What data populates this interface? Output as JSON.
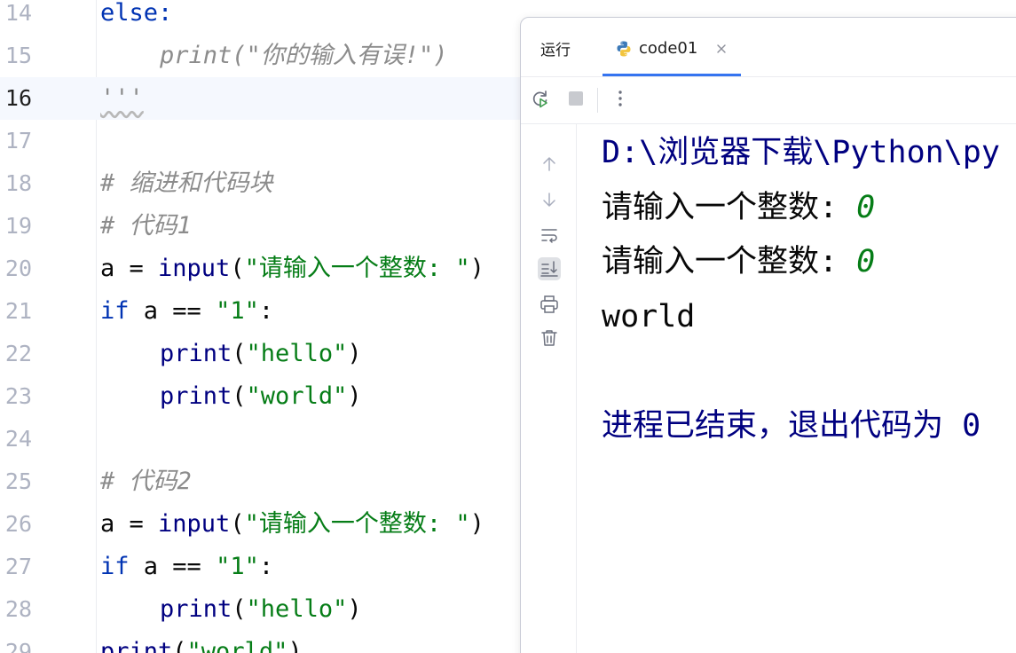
{
  "editor": {
    "lines": [
      {
        "no": "14",
        "parts": [
          {
            "text": "else:",
            "cls": "t-kw"
          }
        ]
      },
      {
        "no": "15",
        "indent": 1,
        "parts": [
          {
            "text": "print(\"你的输入有误!\")",
            "cls": "t-docstr"
          }
        ]
      },
      {
        "no": "16",
        "current": true,
        "parts": [
          {
            "text": "'''",
            "cls": "t-docq"
          }
        ]
      },
      {
        "no": "17",
        "parts": []
      },
      {
        "no": "18",
        "parts": [
          {
            "text": "# 缩进和代码块",
            "cls": "t-cm"
          }
        ]
      },
      {
        "no": "19",
        "parts": [
          {
            "text": "# 代码1",
            "cls": "t-cm"
          }
        ]
      },
      {
        "no": "20",
        "parts": [
          {
            "text": "a = ",
            "cls": ""
          },
          {
            "text": "input",
            "cls": "t-fn"
          },
          {
            "text": "(",
            "cls": ""
          },
          {
            "text": "\"请输入一个整数: \"",
            "cls": "t-str"
          },
          {
            "text": ")",
            "cls": ""
          }
        ]
      },
      {
        "no": "21",
        "parts": [
          {
            "text": "if",
            "cls": "t-kw"
          },
          {
            "text": " a == ",
            "cls": ""
          },
          {
            "text": "\"1\"",
            "cls": "t-str"
          },
          {
            "text": ":",
            "cls": ""
          }
        ]
      },
      {
        "no": "22",
        "indent": 1,
        "parts": [
          {
            "text": "print",
            "cls": "t-fn"
          },
          {
            "text": "(",
            "cls": ""
          },
          {
            "text": "\"hello\"",
            "cls": "t-str"
          },
          {
            "text": ")",
            "cls": ""
          }
        ]
      },
      {
        "no": "23",
        "indent": 1,
        "parts": [
          {
            "text": "print",
            "cls": "t-fn"
          },
          {
            "text": "(",
            "cls": ""
          },
          {
            "text": "\"world\"",
            "cls": "t-str"
          },
          {
            "text": ")",
            "cls": ""
          }
        ]
      },
      {
        "no": "24",
        "parts": []
      },
      {
        "no": "25",
        "parts": [
          {
            "text": "# 代码2",
            "cls": "t-cm"
          }
        ]
      },
      {
        "no": "26",
        "parts": [
          {
            "text": "a = ",
            "cls": ""
          },
          {
            "text": "input",
            "cls": "t-fn"
          },
          {
            "text": "(",
            "cls": ""
          },
          {
            "text": "\"请输入一个整数: \"",
            "cls": "t-str"
          },
          {
            "text": ")",
            "cls": ""
          }
        ]
      },
      {
        "no": "27",
        "parts": [
          {
            "text": "if",
            "cls": "t-kw"
          },
          {
            "text": " a == ",
            "cls": ""
          },
          {
            "text": "\"1\"",
            "cls": "t-str"
          },
          {
            "text": ":",
            "cls": ""
          }
        ]
      },
      {
        "no": "28",
        "indent": 1,
        "parts": [
          {
            "text": "print",
            "cls": "t-fn"
          },
          {
            "text": "(",
            "cls": ""
          },
          {
            "text": "\"hello\"",
            "cls": "t-str"
          },
          {
            "text": ")",
            "cls": ""
          }
        ]
      },
      {
        "no": "29",
        "parts": [
          {
            "text": "print",
            "cls": "t-fn"
          },
          {
            "text": "(",
            "cls": ""
          },
          {
            "text": "\"world\"",
            "cls": "t-str"
          },
          {
            "text": ")",
            "cls": ""
          }
        ]
      }
    ]
  },
  "run_panel": {
    "title": "运行",
    "tab": {
      "label": "code01",
      "icon": "python-icon",
      "close_icon": "close-icon"
    },
    "toolbar": [
      {
        "name": "rerun-icon"
      },
      {
        "name": "stop-icon"
      },
      {
        "name": "more-options-icon"
      }
    ],
    "side_toolbar": [
      {
        "name": "scroll-up-icon"
      },
      {
        "name": "scroll-down-icon"
      },
      {
        "name": "soft-wrap-icon"
      },
      {
        "name": "scroll-to-end-icon",
        "active": true
      },
      {
        "name": "print-icon"
      },
      {
        "name": "delete-icon"
      }
    ],
    "console": {
      "path": "D:\\浏览器下载\\Python\\py",
      "prompt": "请输入一个整数: ",
      "input1": "0",
      "input2": "0",
      "output": "world",
      "exit_message": "进程已结束，退出代码为 0"
    }
  },
  "colors": {
    "accent": "#3574f0",
    "keyword": "#0033b3",
    "string": "#067d17",
    "comment": "#8c8c8c",
    "console_path": "#000080"
  }
}
